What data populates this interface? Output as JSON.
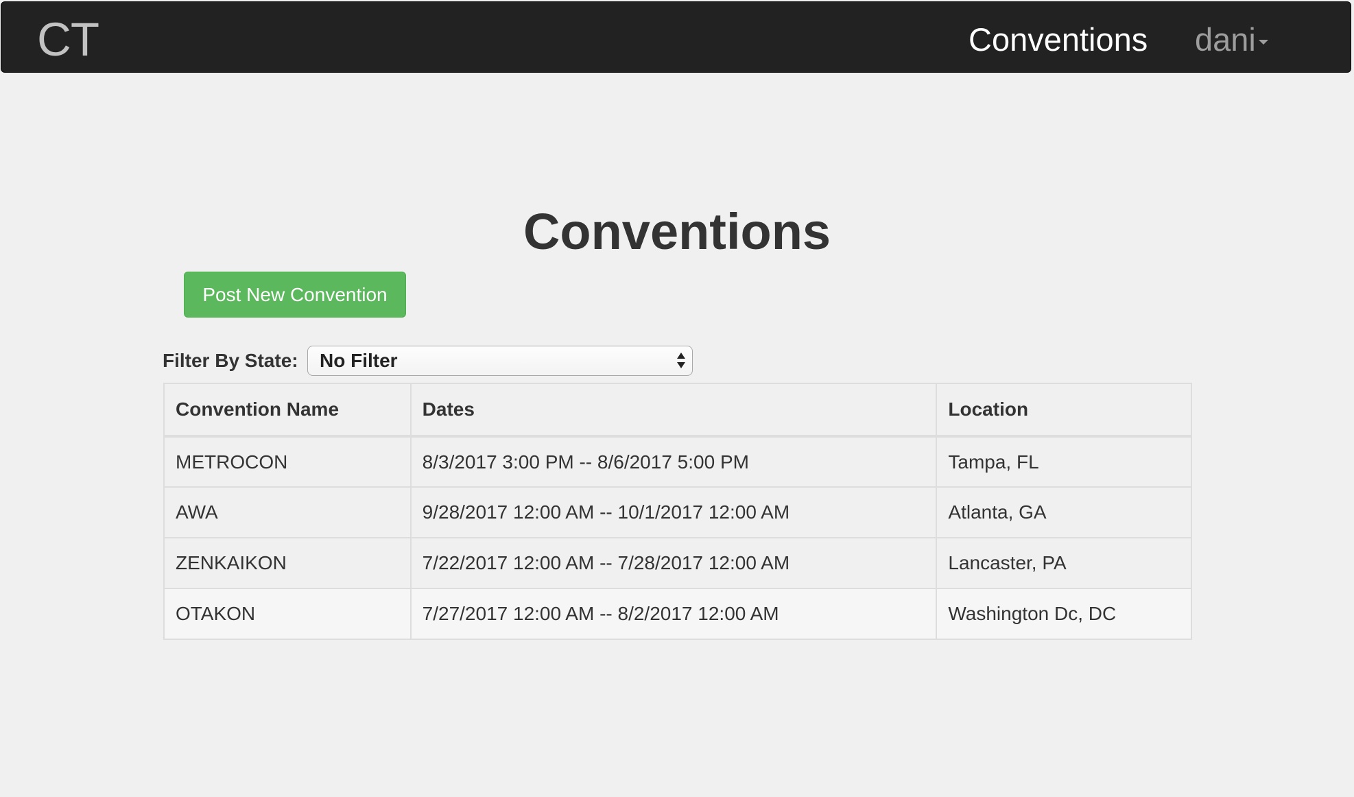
{
  "navbar": {
    "brand": "CT",
    "nav_link": "Conventions",
    "user": "dani"
  },
  "main": {
    "title": "Conventions",
    "post_button": "Post New Convention",
    "filter": {
      "label": "Filter By State:",
      "selected": "No Filter"
    },
    "table": {
      "headers": [
        "Convention Name",
        "Dates",
        "Location"
      ],
      "rows": [
        {
          "name": "METROCON",
          "dates": "8/3/2017 3:00 PM -- 8/6/2017 5:00 PM",
          "location": "Tampa, FL"
        },
        {
          "name": "AWA",
          "dates": "9/28/2017 12:00 AM -- 10/1/2017 12:00 AM",
          "location": "Atlanta, GA"
        },
        {
          "name": "ZENKAIKON",
          "dates": "7/22/2017 12:00 AM -- 7/28/2017 12:00 AM",
          "location": "Lancaster, PA"
        },
        {
          "name": "OTAKON",
          "dates": "7/27/2017 12:00 AM -- 8/2/2017 12:00 AM",
          "location": "Washington Dc, DC"
        }
      ]
    }
  },
  "colors": {
    "navbar_bg": "#222222",
    "success_button": "#5cb85c",
    "page_bg": "#f0f0f0"
  }
}
